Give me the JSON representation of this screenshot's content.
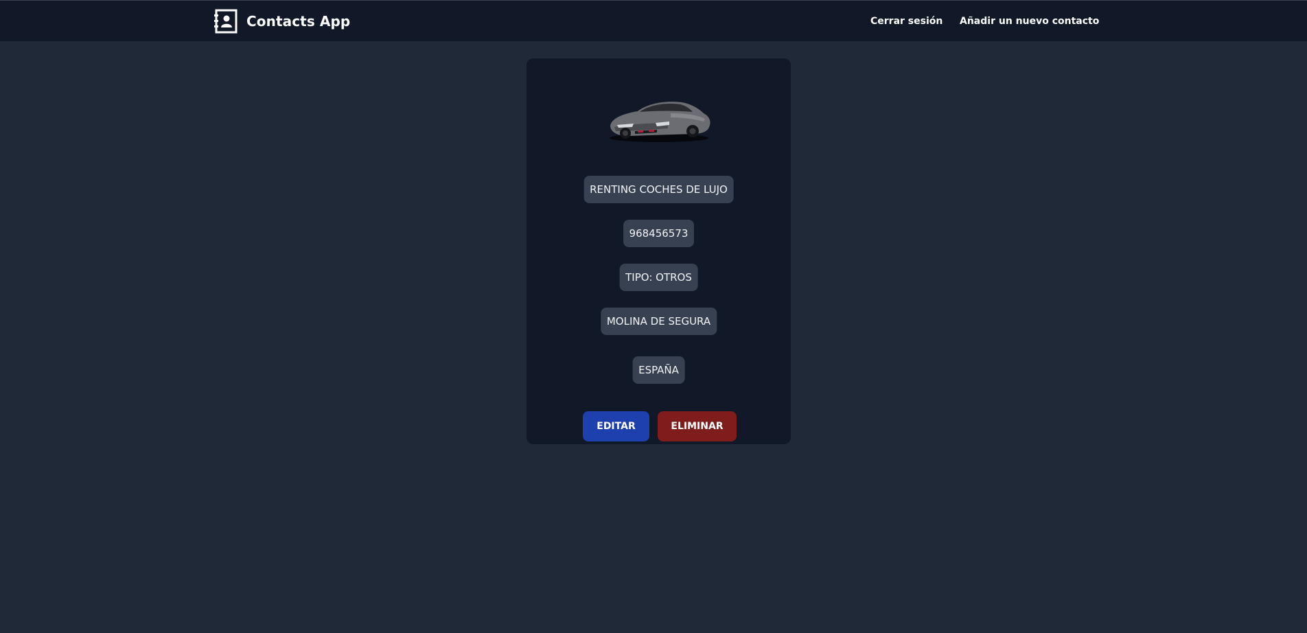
{
  "header": {
    "brand_title": "Contacts App",
    "brand_icon": "contact-book-icon",
    "nav": {
      "logout_label": "Cerrar sesión",
      "add_contact_label": "Añadir un nuevo contacto"
    }
  },
  "contact": {
    "image": "car-image",
    "name": "RENTING COCHES DE LUJO",
    "phone": "968456573",
    "type": "TIPO: OTROS",
    "city": "MOLINA DE SEGURA",
    "country": "ESPAÑA"
  },
  "actions": {
    "edit_label": "EDITAR",
    "delete_label": "ELIMINAR"
  },
  "colors": {
    "page_bg": "#1f2937",
    "navbar_bg": "#111827",
    "card_bg": "#111827",
    "pill_bg": "#374151",
    "edit_button": "#1e40af",
    "delete_button": "#7f1d1d"
  }
}
